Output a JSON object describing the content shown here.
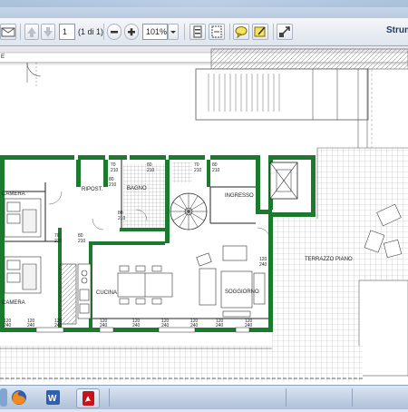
{
  "toolbar": {
    "page_input": "1",
    "page_count": "(1 di 1)",
    "zoom_value": "101%",
    "tools_label": "Strum"
  },
  "plan": {
    "header_letter": "E",
    "rooms": {
      "camera_top": "CAMERA",
      "camera_bottom": "CAMERA",
      "ripost": "RIPOST.",
      "bagno": "BAGNO",
      "ingresso": "INGRESSO",
      "cucina": "CUCINA",
      "soggiorno": "SOGGIORNO",
      "terrazzo": "TERRAZZO PIANO"
    },
    "dims": {
      "d1": "70",
      "d1b": "210",
      "d2": "80",
      "d2b": "210",
      "d3": "70",
      "d3b": "210",
      "d4": "80",
      "d4b": "210",
      "d5": "80",
      "d5b": "210",
      "d6": "70",
      "d6b": "210",
      "d7": "80",
      "d7b": "210",
      "d8": "120",
      "d8b": "240",
      "d9": "120",
      "d9b": "240",
      "d10": "120",
      "d10b": "240",
      "d11": "120",
      "d11b": "240",
      "d12": "120",
      "d12b": "240",
      "d13": "120",
      "d13b": "240",
      "d14": "120",
      "d14b": "240",
      "d15": "120",
      "d15b": "240",
      "d16": "120",
      "d16b": "240",
      "d17": "120",
      "d17b": "240",
      "d18": "80",
      "d18b": "210"
    }
  },
  "taskbar": {
    "word_label": "W"
  }
}
